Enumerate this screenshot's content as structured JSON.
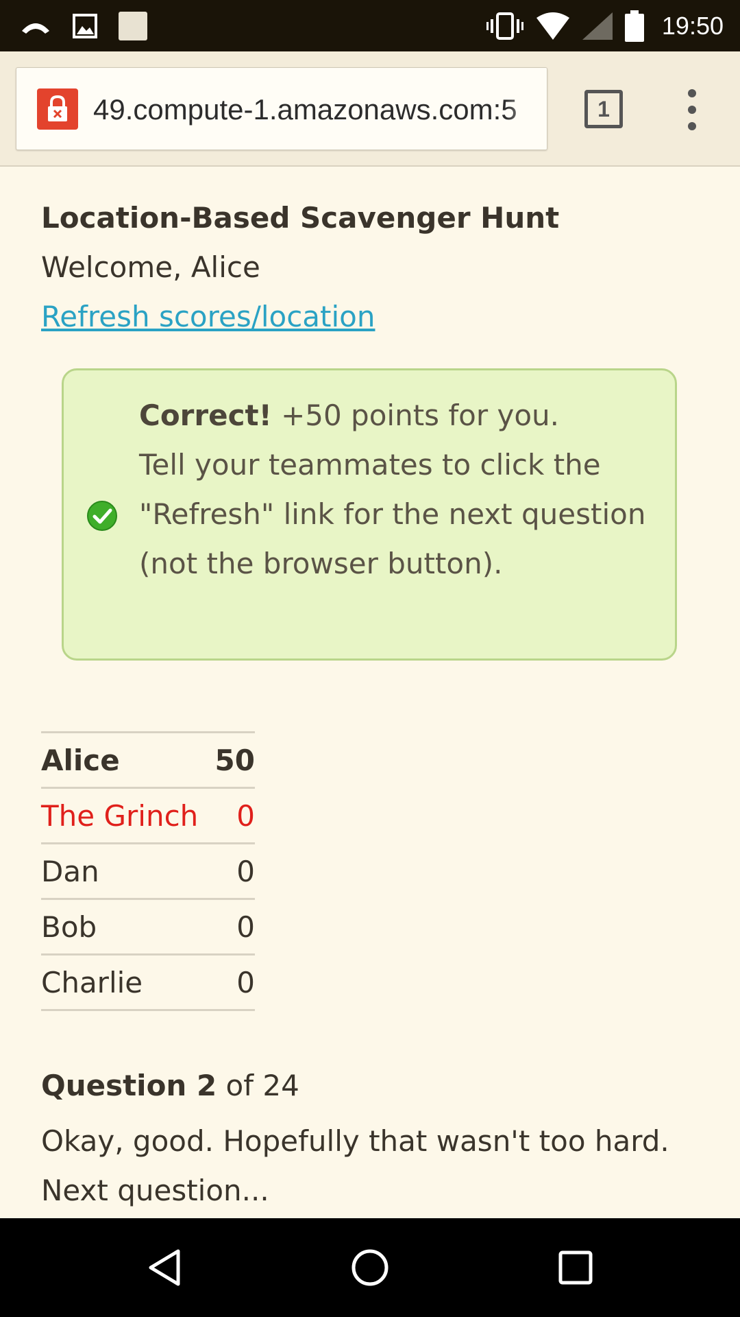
{
  "status_bar": {
    "time": "19:50",
    "left_icons": [
      "missed-call-icon",
      "image-notification-icon",
      "blank-notification-icon"
    ],
    "right_icons": [
      "vibrate-icon",
      "wifi-icon",
      "cellular-signal-icon",
      "battery-icon"
    ]
  },
  "browser": {
    "url": "49.compute-1.amazonaws.com:5",
    "tab_count": "1",
    "security_icon": "broken-lock-icon",
    "menu_icon": "overflow-menu-icon"
  },
  "page": {
    "title": "Location-Based Scavenger Hunt",
    "welcome": "Welcome, Alice",
    "refresh_link": "Refresh scores/location"
  },
  "alert": {
    "icon": "check-circle-icon",
    "strong": "Correct!",
    "points_text": " +50 points for you.",
    "message": "Tell your teammates to click the \"Refresh\" link for the next question (not the browser button).",
    "color": "#e8f5c6"
  },
  "scoreboard": [
    {
      "name": "Alice",
      "score": "50"
    },
    {
      "name": "The Grinch",
      "score": "0"
    },
    {
      "name": "Dan",
      "score": "0"
    },
    {
      "name": "Bob",
      "score": "0"
    },
    {
      "name": "Charlie",
      "score": "0"
    }
  ],
  "question": {
    "label": "Question 2",
    "of_text": " of 24",
    "text": "Okay, good. Hopefully that wasn't too hard. Next question..."
  },
  "nav_bar": {
    "icons": [
      "back-icon",
      "home-icon",
      "recents-icon"
    ]
  },
  "colors": {
    "link": "#2aa2c4",
    "grinch": "#e0201b",
    "background": "#fdf8e9"
  }
}
